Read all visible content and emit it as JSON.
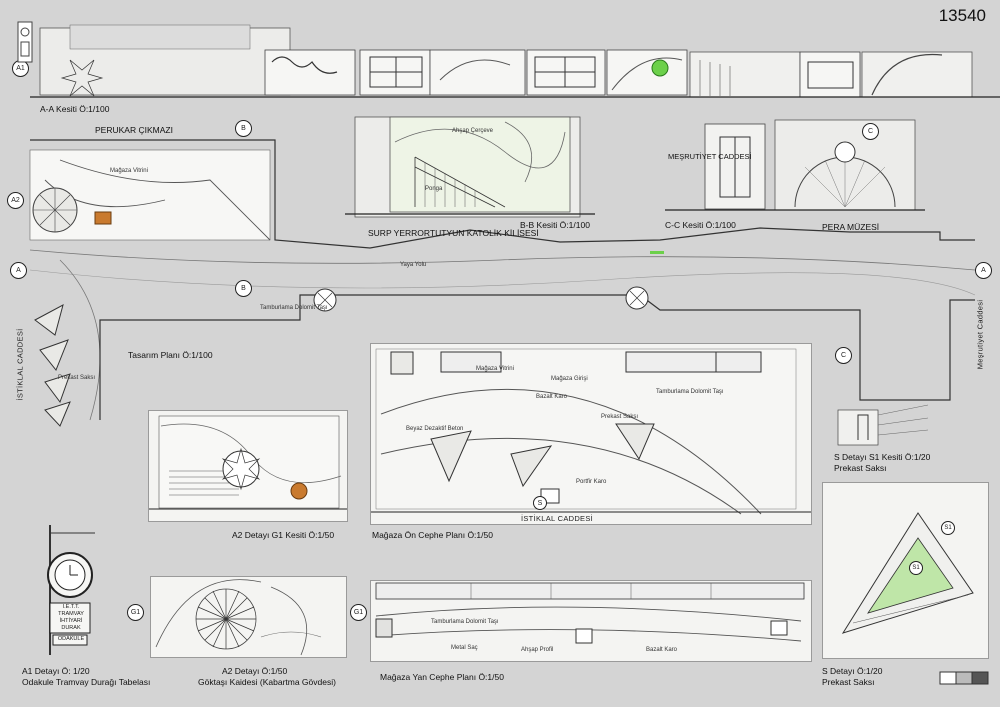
{
  "sheet_number": "13540",
  "sections": {
    "aa": {
      "marker": "A1",
      "title": "A-A Kesiti Ö:1/100"
    },
    "bb": {
      "title": "B-B Kesiti Ö:1/100",
      "labels": [
        "Ahşap Çerçeve",
        "Ponga"
      ]
    },
    "cc": {
      "title": "C-C Kesiti Ö:1/100",
      "building": "MEŞRUTİYET CADDESİ"
    }
  },
  "plan": {
    "title": "Tasarım Planı Ö:1/100",
    "perukar": "PERUKAR ÇIKMAZI",
    "church": "SURP YERRORTUTYUN KATOLİK KİLİSESİ",
    "museum": "PERA MÜZESİ",
    "istiklal": "İSTİKLAL CADDESİ",
    "mesrutiyet": "Meşrutiyet Caddesi",
    "markers": {
      "a2": "A2",
      "b": "B",
      "a": "A",
      "c": "C"
    },
    "small_labels": [
      "Mağaza Vitrini",
      "Yaya Yolu",
      "Tamburlama Dolomit Taşı",
      "Prekast Saksı"
    ]
  },
  "details": {
    "a1": {
      "title": "A1 Detayı Ö: 1/20",
      "subtitle": "Odakule Tramvay Durağı Tabelası",
      "sign": [
        "İ.E.T.T.",
        "TRAMVAY",
        "İHTİYARİ",
        "DURAK"
      ],
      "sign_bottom": "ODAKULE"
    },
    "a2_g1": {
      "title": "A2 Detayı G1 Kesiti Ö:1/50"
    },
    "a2": {
      "title": "A2 Detayı Ö:1/50",
      "subtitle": "Göktaşı Kaidesi (Kabartma Gövdesi)",
      "marker": "G1"
    },
    "magaza_on": {
      "title": "Mağaza Ön Cephe Planı Ö:1/50",
      "street": "İSTİKLAL CADDESİ",
      "marker": "S",
      "labels": [
        "Mağaza Vitrini",
        "Mağaza Girişi",
        "Bazalt Karo",
        "Prekast Saksı",
        "Beyaz Dezaktif Beton",
        "Portfir Karo",
        "Tamburlama Dolomit Taşı"
      ]
    },
    "magaza_yan": {
      "title": "Mağaza Yan Cephe Planı Ö:1/50",
      "labels": [
        "Tamburlama Dolomit Taşı",
        "Metal Saç",
        "Ahşap Profil",
        "Bazalt Karo"
      ]
    },
    "s1": {
      "title": "S Detayı S1 Kesiti Ö:1/20",
      "subtitle": "Prekast Saksı"
    },
    "s": {
      "title": "S Detayı Ö:1/20",
      "subtitle": "Prekast Saksı",
      "marker": "S1"
    }
  },
  "colors": {
    "sheet": "#d4d4d4",
    "paper": "#f4f4f2",
    "line": "#3a3a3a",
    "accent_green": "#bfe6a8",
    "wood": "#c97a2e"
  }
}
